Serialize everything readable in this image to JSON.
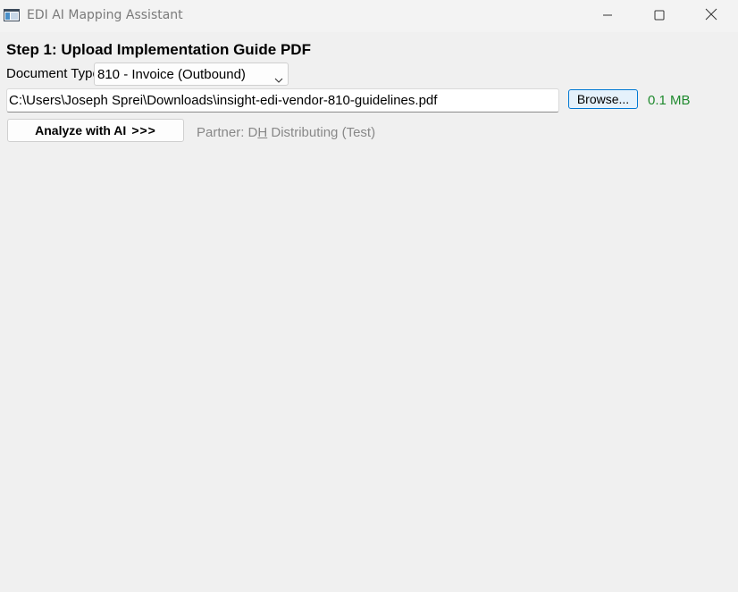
{
  "window": {
    "title": "EDI AI Mapping Assistant"
  },
  "step1": {
    "title": "Step 1: Upload Implementation Guide PDF",
    "document_type_label": "Document Type:",
    "document_type_selected": "810 - Invoice (Outbound)",
    "file_path": "C:\\Users\\Joseph Sprei\\Downloads\\insight-edi-vendor-810-guidelines.pdf",
    "browse_label": "Browse...",
    "file_size": "0.1 MB",
    "analyze_label": "Analyze with AI",
    "analyze_arrows": ">>>",
    "partner_prefix": "Partner: D",
    "partner_underlined": "H",
    "partner_suffix": " Distributing (Test)"
  },
  "colors": {
    "background": "#f0f0f0",
    "accent": "#0078d4",
    "file_size_green": "#1f8a2e",
    "partner_gray": "#888888"
  },
  "icons": {
    "app": "app-window-icon",
    "minimize": "minimize-icon",
    "maximize": "maximize-icon",
    "close": "close-icon",
    "dropdown": "chevron-down-icon"
  }
}
